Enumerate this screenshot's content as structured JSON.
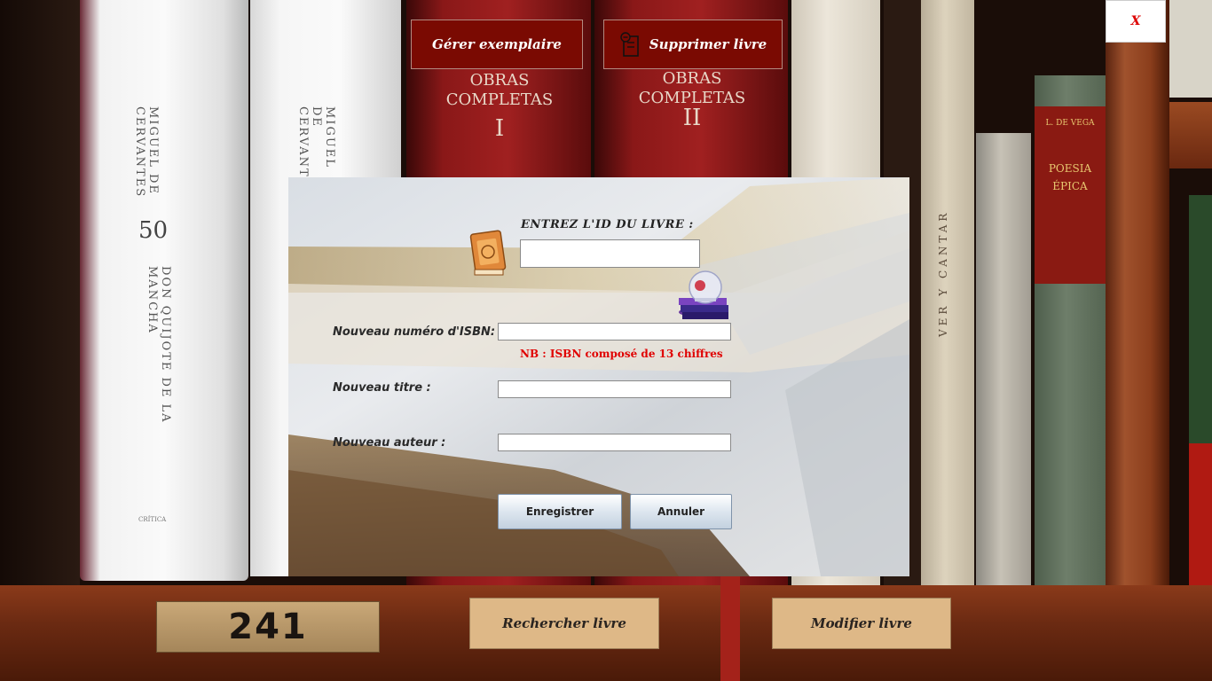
{
  "window": {
    "close_label": "X"
  },
  "top_buttons": {
    "manage_copy": "Gérer exemplaire",
    "delete_book": "Supprimer livre"
  },
  "bottom_buttons": {
    "search_book": "Rechercher livre",
    "edit_book": "Modifier livre"
  },
  "shelf": {
    "label_number": "241"
  },
  "background_books": {
    "book1_author": "MIGUEL DE CERVANTES",
    "book1_number": "50",
    "book1_title": "DON QUIJOTE DE LA MANCHA",
    "book1_publisher": "CRÍTICA",
    "book2_author": "MIGUEL DE CERVANT",
    "book3_title": "OBRAS COMPLETAS",
    "book3_volume": "I",
    "book4_title": "OBRAS COMPLETAS",
    "book4_volume": "II",
    "book5_title": "L. DE VEGA",
    "book5_subtitle": "POESIA ÉPICA",
    "book6_title": "VER Y CANTAR"
  },
  "form": {
    "id_prompt": "ENTREZ L'ID DU LIVRE :",
    "id_value": "",
    "isbn_label": "Nouveau numéro d'ISBN:",
    "isbn_value": "",
    "isbn_note": "NB : ISBN composé de 13 chiffres",
    "title_label": "Nouveau titre :",
    "title_value": "",
    "author_label": "Nouveau auteur :",
    "author_value": "",
    "save_label": "Enregistrer",
    "cancel_label": "Annuler"
  },
  "colors": {
    "top_button_bg": "#7a0a02",
    "bottom_button_bg": "#deb887",
    "note_text": "#e00000",
    "close_text": "#dd0000"
  }
}
